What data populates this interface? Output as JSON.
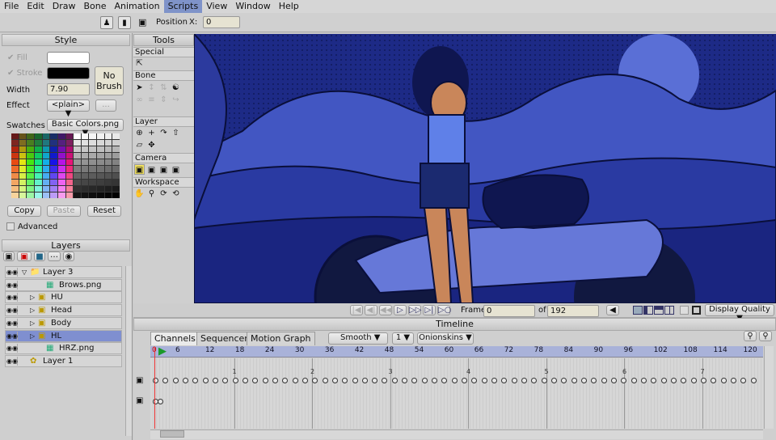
{
  "menu": [
    "File",
    "Edit",
    "Draw",
    "Bone",
    "Animation",
    "Scripts",
    "View",
    "Window",
    "Help"
  ],
  "menu_active": "Scripts",
  "toolbar": {
    "position_label": "Position",
    "x_label": "X:",
    "x_value": "0"
  },
  "style": {
    "title": "Style",
    "fill_label": "Fill",
    "stroke_label": "Stroke",
    "width_label": "Width",
    "width_value": "7.90",
    "effect_label": "Effect",
    "effect_value": "<plain>",
    "effect_more": "...",
    "no_brush": "No Brush",
    "swatches_label": "Swatches",
    "swatches_value": "Basic Colors.png",
    "copy": "Copy",
    "paste": "Paste",
    "reset": "Reset",
    "advanced": "Advanced",
    "fill_color": "#ffffff",
    "stroke_color": "#000000"
  },
  "tools": {
    "title": "Tools",
    "sections": [
      "Special",
      "Bone",
      "Layer",
      "Camera",
      "Workspace"
    ]
  },
  "layers": {
    "title": "Layers",
    "items": [
      {
        "name": "Layer 3",
        "type": "folder",
        "indent": 0,
        "expanded": true
      },
      {
        "name": "Brows.png",
        "type": "image",
        "indent": 2
      },
      {
        "name": "HU",
        "type": "bone",
        "indent": 1
      },
      {
        "name": "Head",
        "type": "bone",
        "indent": 1
      },
      {
        "name": "Body",
        "type": "bone",
        "indent": 1
      },
      {
        "name": "HL",
        "type": "bone",
        "indent": 1,
        "selected": true
      },
      {
        "name": "HRZ.png",
        "type": "image",
        "indent": 2
      },
      {
        "name": "Layer 1",
        "type": "vector",
        "indent": 0
      }
    ]
  },
  "playback": {
    "frame_label": "Frame",
    "frame_value": "0",
    "of_label": "of",
    "total": "192",
    "display_quality": "Display Quality"
  },
  "timeline": {
    "title": "Timeline",
    "tabs": [
      "Channels",
      "Sequencer",
      "Motion Graph"
    ],
    "active_tab": "Channels",
    "interp": "Smooth",
    "step": "1",
    "onionskins": "Onionskins",
    "ruler": [
      "0",
      "6",
      "12",
      "18",
      "24",
      "30",
      "36",
      "42",
      "48",
      "54",
      "60",
      "66",
      "72",
      "78",
      "84",
      "90",
      "96",
      "102",
      "108",
      "114",
      "120"
    ],
    "seconds": [
      "1",
      "2",
      "3",
      "4",
      "5",
      "6",
      "7"
    ]
  },
  "colors": {
    "canvas_bg": "#1d2a86",
    "selection": "#7f8fd0",
    "accent": "#7f93c9"
  }
}
